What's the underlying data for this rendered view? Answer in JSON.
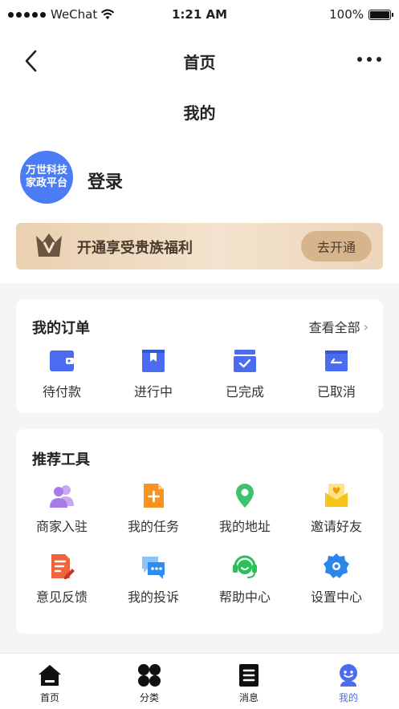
{
  "status_bar": {
    "carrier": "WeChat",
    "time": "1:21 AM",
    "battery": "100%"
  },
  "nav": {
    "title": "首页"
  },
  "profile": {
    "heading": "我的",
    "avatar_line1": "万世科技",
    "avatar_line2": "家政平台",
    "login_label": "登录",
    "vip_text": "开通享受贵族福利",
    "vip_button": "去开通"
  },
  "orders": {
    "title": "我的订单",
    "view_all": "查看全部",
    "items": [
      {
        "label": "待付款",
        "icon": "wallet-icon"
      },
      {
        "label": "进行中",
        "icon": "bookmark-box-icon"
      },
      {
        "label": "已完成",
        "icon": "check-box-icon"
      },
      {
        "label": "已取消",
        "icon": "cancel-box-icon"
      }
    ]
  },
  "tools": {
    "title": "推荐工具",
    "items": [
      {
        "label": "商家入驻",
        "icon": "users-icon",
        "color": "#a97be8"
      },
      {
        "label": "我的任务",
        "icon": "task-doc-icon",
        "color": "#f7931e"
      },
      {
        "label": "我的地址",
        "icon": "location-pin-icon",
        "color": "#3ec26d"
      },
      {
        "label": "邀请好友",
        "icon": "invite-envelope-icon",
        "color": "#f5c518"
      },
      {
        "label": "意见反馈",
        "icon": "feedback-edit-icon",
        "color": "#f0643c"
      },
      {
        "label": "我的投诉",
        "icon": "complaint-chat-icon",
        "color": "#2f8df0"
      },
      {
        "label": "帮助中心",
        "icon": "headset-icon",
        "color": "#2cc05a"
      },
      {
        "label": "设置中心",
        "icon": "gear-icon",
        "color": "#2a86e8"
      }
    ]
  },
  "tab_bar": {
    "items": [
      {
        "label": "首页",
        "icon": "home-icon"
      },
      {
        "label": "分类",
        "icon": "category-icon"
      },
      {
        "label": "消息",
        "icon": "message-list-icon"
      },
      {
        "label": "我的",
        "icon": "profile-icon",
        "active": true
      }
    ],
    "active_color": "#4b6cf0"
  }
}
